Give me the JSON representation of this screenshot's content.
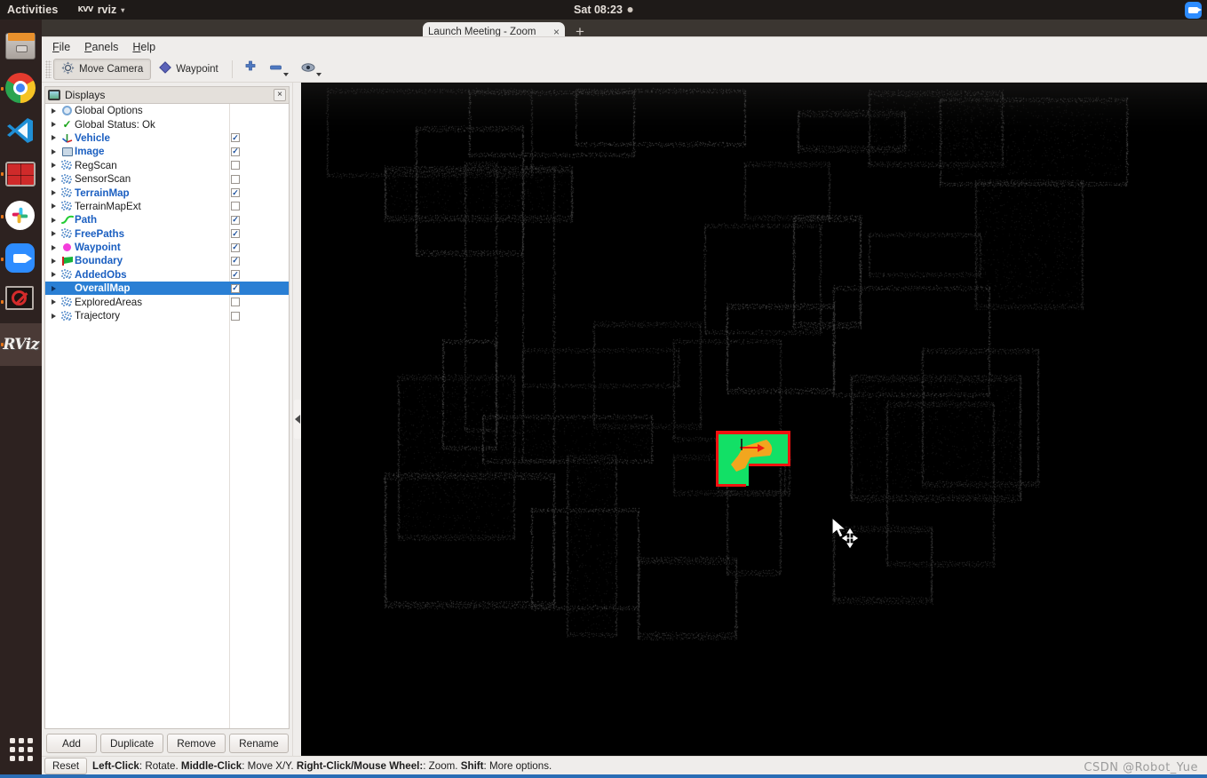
{
  "desktop": {
    "activities": "Activities",
    "app_menu": {
      "icon": "KVV",
      "label": "rviz",
      "caret": "▾"
    },
    "clock": "Sat 08:23",
    "tray_icons": [
      "zoom-tray-icon"
    ]
  },
  "dock": {
    "items": [
      {
        "name": "files",
        "icon": "files-icon",
        "running": false,
        "active": false
      },
      {
        "name": "google-chrome",
        "icon": "chrome-icon",
        "running": true,
        "active": false
      },
      {
        "name": "visual-studio-code",
        "icon": "vscode-icon",
        "running": false,
        "active": false
      },
      {
        "name": "terminal",
        "icon": "terminal-icon",
        "running": true,
        "active": false
      },
      {
        "name": "slack",
        "icon": "slack-icon",
        "running": true,
        "active": false
      },
      {
        "name": "zoom",
        "icon": "zoom-icon",
        "running": true,
        "active": false
      },
      {
        "name": "terminal-blocked",
        "icon": "terminal-blocked-icon",
        "running": true,
        "active": false
      },
      {
        "name": "rviz",
        "icon": "rviz-icon",
        "running": true,
        "active": true
      }
    ],
    "show_applications": "show-applications-icon"
  },
  "background_browser": {
    "tab_title": "Launch Meeting - Zoom",
    "tab_close": "×",
    "new_tab": "+"
  },
  "menubar": {
    "items": [
      "File",
      "Panels",
      "Help"
    ]
  },
  "toolbar": {
    "buttons": [
      {
        "label": "Move Camera",
        "icon": "move-camera-icon",
        "checked": true
      },
      {
        "label": "Waypoint",
        "icon": "waypoint-diamond-icon",
        "checked": false
      }
    ],
    "icon_buttons": [
      {
        "name": "add-tool-button",
        "icon": "plus-icon",
        "has_caret": false
      },
      {
        "name": "remove-tool-button",
        "icon": "minus-icon",
        "has_caret": true
      },
      {
        "name": "focus-camera-button",
        "icon": "eye-icon",
        "has_caret": true
      }
    ]
  },
  "displays_panel": {
    "title": "Displays",
    "title_icon": "monitor-icon",
    "close_label": "×",
    "tree": [
      {
        "label": "Global Options",
        "icon": "gear-icon",
        "bold": false,
        "checkbox": null,
        "selected": false
      },
      {
        "label": "Global Status: Ok",
        "icon": "check-icon",
        "bold": false,
        "checkbox": null,
        "selected": false
      },
      {
        "label": "Vehicle",
        "icon": "axes-icon",
        "bold": true,
        "checkbox": true,
        "selected": false
      },
      {
        "label": "Image",
        "icon": "image-icon",
        "bold": true,
        "checkbox": true,
        "selected": false
      },
      {
        "label": "RegScan",
        "icon": "pointcloud-icon",
        "bold": false,
        "checkbox": false,
        "selected": false
      },
      {
        "label": "SensorScan",
        "icon": "pointcloud-icon",
        "bold": false,
        "checkbox": false,
        "selected": false
      },
      {
        "label": "TerrainMap",
        "icon": "pointcloud-icon",
        "bold": true,
        "checkbox": true,
        "selected": false
      },
      {
        "label": "TerrainMapExt",
        "icon": "pointcloud-icon",
        "bold": false,
        "checkbox": false,
        "selected": false
      },
      {
        "label": "Path",
        "icon": "path-icon",
        "bold": true,
        "checkbox": true,
        "selected": false
      },
      {
        "label": "FreePaths",
        "icon": "pointcloud-icon",
        "bold": true,
        "checkbox": true,
        "selected": false
      },
      {
        "label": "Waypoint",
        "icon": "magenta-dot-icon",
        "bold": true,
        "checkbox": true,
        "selected": false
      },
      {
        "label": "Boundary",
        "icon": "boundary-icon",
        "bold": true,
        "checkbox": true,
        "selected": false
      },
      {
        "label": "AddedObs",
        "icon": "pointcloud-icon",
        "bold": true,
        "checkbox": true,
        "selected": false
      },
      {
        "label": "OverallMap",
        "icon": "none",
        "bold": true,
        "checkbox": true,
        "selected": true
      },
      {
        "label": "ExploredAreas",
        "icon": "pointcloud-icon",
        "bold": false,
        "checkbox": false,
        "selected": false
      },
      {
        "label": "Trajectory",
        "icon": "pointcloud-icon",
        "bold": false,
        "checkbox": false,
        "selected": false
      }
    ],
    "buttons": [
      "Add",
      "Duplicate",
      "Remove",
      "Rename"
    ]
  },
  "statusbar": {
    "reset_label": "Reset",
    "hint_parts": [
      {
        "text": "Left-Click",
        "bold": true
      },
      {
        "text": ": Rotate. ",
        "bold": false
      },
      {
        "text": "Middle-Click",
        "bold": true
      },
      {
        "text": ": Move X/Y. ",
        "bold": false
      },
      {
        "text": "Right-Click/Mouse Wheel:",
        "bold": true
      },
      {
        "text": ": Zoom. ",
        "bold": false
      },
      {
        "text": "Shift",
        "bold": true
      },
      {
        "text": ": More options.",
        "bold": false
      }
    ]
  },
  "viewport": {
    "background_color": "#000000",
    "free_space_color": "#12e066",
    "boundary_color": "#f0110f",
    "sensor_cone_color": "#f2a61e",
    "heading_arrow_color": "#ef1b12",
    "pointcloud_color": "#2a2a2a",
    "cursor": "arrow-move-cursor"
  },
  "watermark": "CSDN @Robot_Yue",
  "colors": {
    "selection_blue": "#2a7fd4",
    "label_blue": "#1b5fc1",
    "panel_bg": "#efedeb"
  }
}
